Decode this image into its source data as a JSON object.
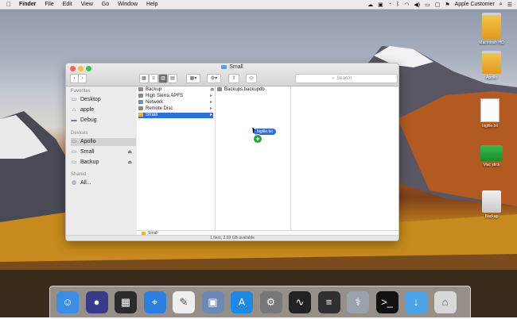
{
  "menubar": {
    "apple": "",
    "items": [
      "Finder",
      "File",
      "Edit",
      "View",
      "Go",
      "Window",
      "Help"
    ],
    "user": "Apple Customer"
  },
  "window": {
    "title": "Small",
    "search_placeholder": "Search",
    "sidebar": {
      "favorites_header": "Favorites",
      "favorites": [
        {
          "label": "Desktop",
          "icon": "desktop-icon"
        },
        {
          "label": "apple",
          "icon": "home-icon"
        },
        {
          "label": "Debug",
          "icon": "folder-icon"
        }
      ],
      "devices_header": "Devices",
      "devices": [
        {
          "label": "Apollo",
          "icon": "disk-icon"
        },
        {
          "label": "Small",
          "icon": "disk-icon"
        },
        {
          "label": "Backup",
          "icon": "disk-icon"
        }
      ],
      "shared_header": "Shared",
      "shared": [
        {
          "label": "All...",
          "icon": "globe-icon"
        }
      ]
    },
    "column1": [
      {
        "label": "Backup",
        "color": "#8a8a8a"
      },
      {
        "label": "High Sierra APFS",
        "color": "#8a8a8a"
      },
      {
        "label": "Network",
        "color": "#6b8fc9"
      },
      {
        "label": "Remote Disc",
        "color": "#8a8a8a"
      },
      {
        "label": "Small",
        "color": "#f0b33a"
      }
    ],
    "column2": [
      {
        "label": "Backups.backupdb",
        "color": "#8a8a8a"
      }
    ],
    "drag_label": "bigfile.txt",
    "pathbar": "Small",
    "status": "1 item, 2.69 GB available"
  },
  "desktop_icons": [
    {
      "label": "Macintosh HD"
    },
    {
      "label": "Apollo"
    },
    {
      "label": "bigfile.txt"
    },
    {
      "label": "Mac stick"
    },
    {
      "label": "Backup"
    }
  ],
  "dock": [
    {
      "name": "finder-icon",
      "color": "#3a8ee6",
      "glyph": "☺"
    },
    {
      "name": "siri-icon",
      "color": "#3a3a8a",
      "glyph": "●"
    },
    {
      "name": "launchpad-icon",
      "color": "#2b2b2b",
      "glyph": "▦"
    },
    {
      "name": "safari-icon",
      "color": "#2c7fe0",
      "glyph": "⌖"
    },
    {
      "name": "notes-icon",
      "color": "#eeeeee",
      "glyph": "✎"
    },
    {
      "name": "preview-icon",
      "color": "#6c88b5",
      "glyph": "▣"
    },
    {
      "name": "app-store-icon",
      "color": "#1e88e5",
      "glyph": "A"
    },
    {
      "name": "system-preferences-icon",
      "color": "#777777",
      "glyph": "⚙"
    },
    {
      "name": "activity-monitor-icon",
      "color": "#222222",
      "glyph": "∿"
    },
    {
      "name": "console-icon",
      "color": "#303030",
      "glyph": "≡"
    },
    {
      "name": "disk-utility-icon",
      "color": "#9aa2ad",
      "glyph": "⚕"
    },
    {
      "name": "terminal-icon",
      "color": "#111111",
      "glyph": ">_"
    },
    {
      "name": "downloads-folder-icon",
      "color": "#4aa3e6",
      "glyph": "↓"
    },
    {
      "name": "trash-icon",
      "color": "#d8d8d8",
      "glyph": "⌂"
    }
  ]
}
